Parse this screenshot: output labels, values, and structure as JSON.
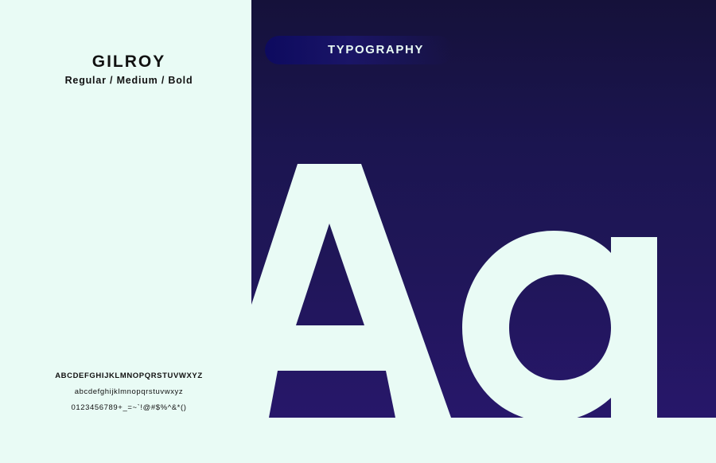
{
  "font": {
    "name": "GILROY",
    "weights": "Regular / Medium / Bold"
  },
  "charset": {
    "uppercase": "ABCDEFGHIJKLMNOPQRSTUVWXYZ",
    "lowercase": "abcdefghijklmnopqrstuvwxyz",
    "digits_symbols": "0123456789+_=~`!@#$%^&*()"
  },
  "hero": {
    "badge": "TYPOGRAPHY",
    "sample_glyphs": "Aa"
  },
  "colors": {
    "background": "#e9fbf5",
    "hero_dark": "#15113a",
    "hero_light": "#27176a",
    "glyph": "#e9fbf5",
    "badge": "#0d0a5f"
  }
}
